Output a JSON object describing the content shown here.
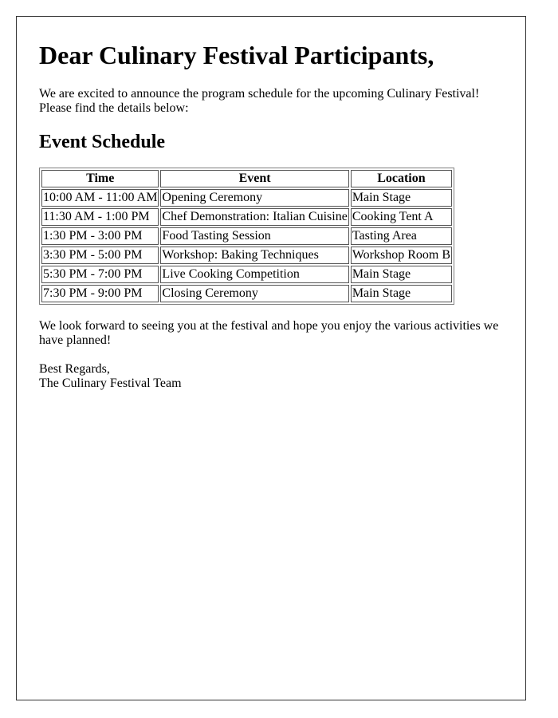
{
  "letter": {
    "greeting": "Dear Culinary Festival Participants,",
    "intro_line1": "We are excited to announce the program schedule for the upcoming Culinary Festival!",
    "intro_line2": "Please find the details below:",
    "schedule_heading": "Event Schedule",
    "table": {
      "headers": [
        "Time",
        "Event",
        "Location"
      ],
      "rows": [
        [
          "10:00 AM - 11:00 AM",
          "Opening Ceremony",
          "Main Stage"
        ],
        [
          "11:30 AM - 1:00 PM",
          "Chef Demonstration: Italian Cuisine",
          "Cooking Tent A"
        ],
        [
          "1:30 PM - 3:00 PM",
          "Food Tasting Session",
          "Tasting Area"
        ],
        [
          "3:30 PM - 5:00 PM",
          "Workshop: Baking Techniques",
          "Workshop Room B"
        ],
        [
          "5:30 PM - 7:00 PM",
          "Live Cooking Competition",
          "Main Stage"
        ],
        [
          "7:30 PM - 9:00 PM",
          "Closing Ceremony",
          "Main Stage"
        ]
      ]
    },
    "closing": "We look forward to seeing you at the festival and hope you enjoy the various activities we have planned!",
    "signoff_line1": "Best Regards,",
    "signoff_line2": "The Culinary Festival Team"
  }
}
